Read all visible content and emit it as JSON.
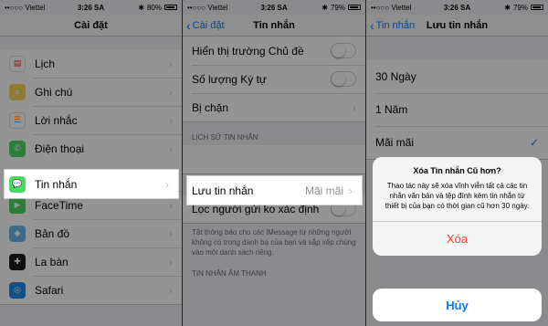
{
  "status": {
    "s1": {
      "carrier": "••○○○ Viettel",
      "time": "3:26 SA",
      "battery": "80%"
    },
    "s2": {
      "carrier": "••○○○ Viettel",
      "time": "3:26 SA",
      "battery": "79%"
    },
    "s3": {
      "carrier": "••○○○ Viettel",
      "time": "3:26 SA",
      "battery": "79%"
    }
  },
  "screen1": {
    "title": "Cài đặt",
    "items": [
      {
        "label": "Lịch",
        "icon": "calendar-icon",
        "color": "#ffffff"
      },
      {
        "label": "Ghi chú",
        "icon": "notes-icon",
        "color": "#f7d45a"
      },
      {
        "label": "Lời nhắc",
        "icon": "reminders-icon",
        "color": "#ffffff"
      },
      {
        "label": "Điện thoại",
        "icon": "phone-icon",
        "color": "#4cd964"
      },
      {
        "label": "Tin nhắn",
        "icon": "messages-icon",
        "color": "#4cd964"
      },
      {
        "label": "FaceTime",
        "icon": "facetime-icon",
        "color": "#4cd964"
      },
      {
        "label": "Bản đồ",
        "icon": "maps-icon",
        "color": "#6ab8e8"
      },
      {
        "label": "La bàn",
        "icon": "compass-icon",
        "color": "#1c1c1e"
      },
      {
        "label": "Safari",
        "icon": "safari-icon",
        "color": "#1e88e5"
      }
    ]
  },
  "screen2": {
    "back": "Cài đặt",
    "title": "Tin nhắn",
    "show_subject": "Hiển thị trường Chủ đề",
    "char_count": "Số lượng Ký tự",
    "blocked": "Bị chặn",
    "history_header": "LỊCH SỬ TIN NHẮN",
    "keep_messages": "Lưu tin nhắn",
    "keep_value": "Mãi mãi",
    "filter_unknown": "Lọc người gửi ko xác định",
    "filter_footer": "Tắt thông báo cho các iMessage từ những người không có trong danh bạ của bạn và sắp xếp chúng vào một danh sách riêng.",
    "audio_header": "TIN NHẮN ÂM THANH"
  },
  "screen3": {
    "back": "Tin nhắn",
    "title": "Lưu tin nhắn",
    "options": [
      "30 Ngày",
      "1 Năm",
      "Mãi mãi"
    ],
    "alert_title": "Xóa Tin nhắn Cũ hơn?",
    "alert_message": "Thao tác này sẽ xóa vĩnh viễn tất cả các tin nhắn văn bản và tệp đính kèm tin nhắn từ thiết bị của bạn có thời gian cũ hơn 30 ngày.",
    "delete": "Xóa",
    "cancel": "Hủy"
  }
}
